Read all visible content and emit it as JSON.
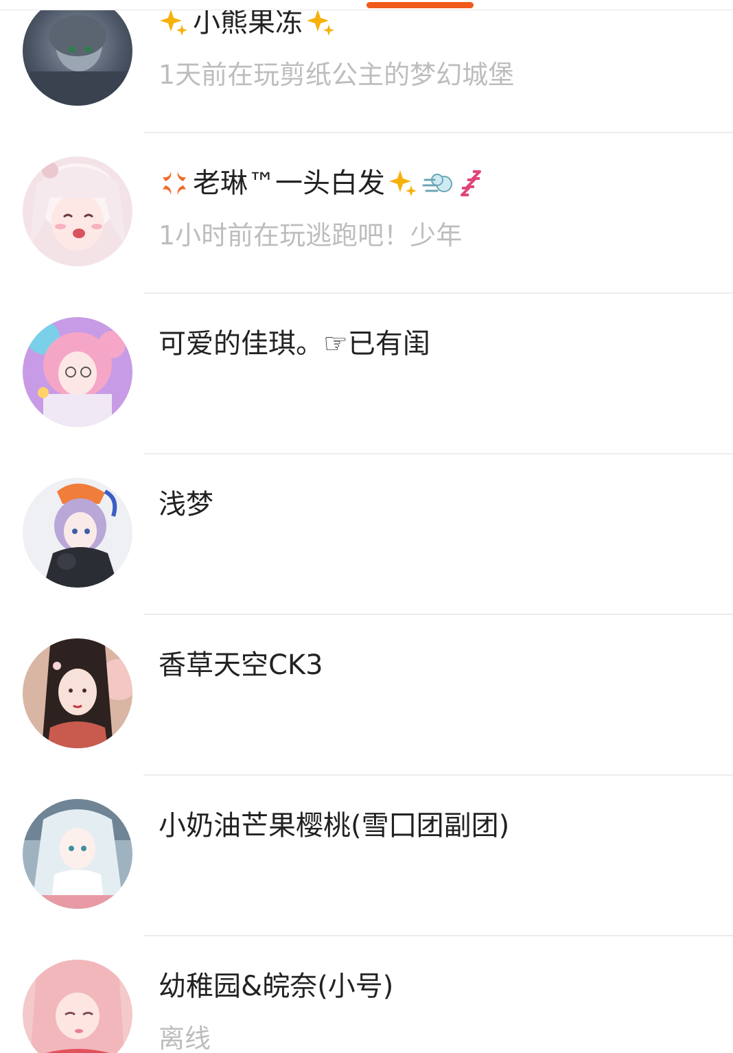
{
  "accent_color": "#f05a1a",
  "friends": [
    {
      "name": "小熊果冻",
      "status": "1天前在玩剪纸公主的梦幻城堡",
      "name_prefix_icons": [
        "sparkles-icon"
      ],
      "name_suffix_icons": [
        "sparkles-icon"
      ]
    },
    {
      "name": "老琳™一头白发",
      "status": "1小时前在玩逃跑吧！少年",
      "name_prefix_icons": [
        "anger-symbol-icon"
      ],
      "name_suffix_icons": [
        "sparkles-icon",
        "dash-icon",
        "zzz-icon"
      ]
    },
    {
      "name": "可爱的佳琪。☞已有闺",
      "status": ""
    },
    {
      "name": "浅梦",
      "status": ""
    },
    {
      "name": "香草天空CK3",
      "status": ""
    },
    {
      "name": "小奶油芒果樱桃(雪囗团副团)",
      "status": ""
    },
    {
      "name": "幼稚园&皖奈(小号)",
      "status": "离线"
    }
  ]
}
